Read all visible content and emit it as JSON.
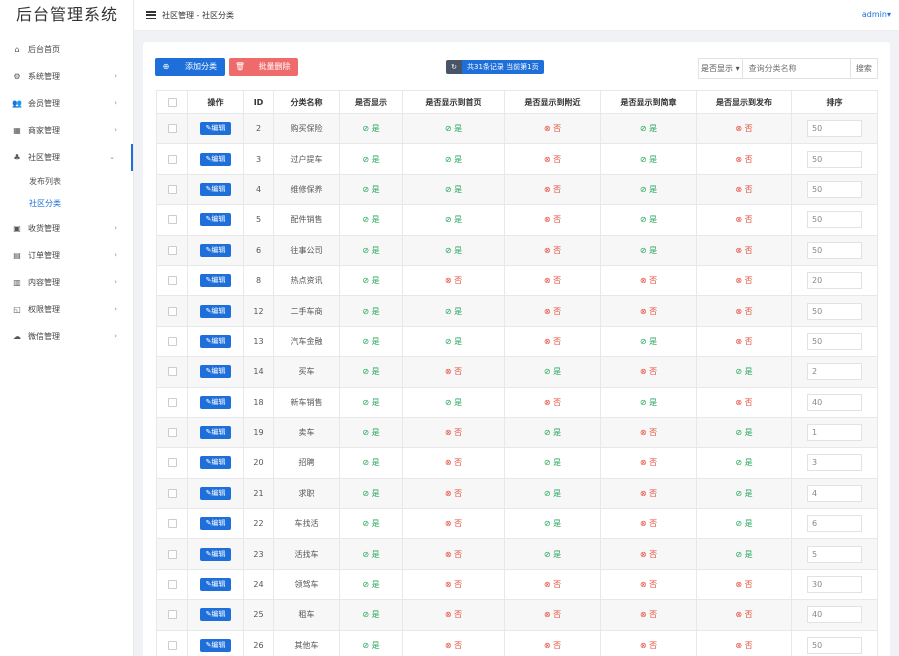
{
  "brand": "后台管理系统",
  "breadcrumb": "社区管理 - 社区分类",
  "user": "admin",
  "sidebar": {
    "items": [
      {
        "label": "后台首页",
        "icon": "home-icon",
        "glyph": "⌂",
        "arrow": ""
      },
      {
        "label": "系统管理",
        "icon": "gear-icon",
        "glyph": "⚙",
        "arrow": "›"
      },
      {
        "label": "会员管理",
        "icon": "users-icon",
        "glyph": "👥",
        "arrow": "›"
      },
      {
        "label": "商家管理",
        "icon": "store-icon",
        "glyph": "▦",
        "arrow": "›"
      },
      {
        "label": "社区管理",
        "icon": "community-icon",
        "glyph": "♣",
        "arrow": "⌄"
      },
      {
        "label": "收货管理",
        "icon": "box-icon",
        "glyph": "▣",
        "arrow": "›"
      },
      {
        "label": "订单管理",
        "icon": "clipboard-icon",
        "glyph": "▤",
        "arrow": "›"
      },
      {
        "label": "内容管理",
        "icon": "document-icon",
        "glyph": "▥",
        "arrow": "›"
      },
      {
        "label": "权限管理",
        "icon": "shield-icon",
        "glyph": "◱",
        "arrow": "›"
      },
      {
        "label": "微信管理",
        "icon": "wechat-icon",
        "glyph": "☁",
        "arrow": "›"
      }
    ],
    "sub_items": [
      {
        "label": "发布列表"
      },
      {
        "label": "社区分类"
      }
    ]
  },
  "toolbar": {
    "add_label": "添加分类",
    "add_icon": "⊕",
    "batch_delete_label": "批量删除",
    "batch_delete_icon": "🗑",
    "stats_icon": "↻",
    "stats_text": "共31条记录 当前第1页",
    "filter_select": "是否显示 ▾",
    "search_placeholder": "查询分类名称",
    "search_button": "搜索"
  },
  "table": {
    "headers": [
      "",
      "操作",
      "ID",
      "分类名称",
      "是否显示",
      "是否显示到首页",
      "是否显示到附近",
      "是否显示到简章",
      "是否显示到发布",
      "排序"
    ],
    "edit_label": "✎编辑",
    "yes_label": "⊘ 是",
    "no_label": "⊗ 否",
    "rows": [
      {
        "id": "2",
        "name": "购买保险",
        "flags": [
          1,
          1,
          0,
          1,
          0
        ],
        "sort": "50"
      },
      {
        "id": "3",
        "name": "过户提车",
        "flags": [
          1,
          1,
          0,
          1,
          0
        ],
        "sort": "50"
      },
      {
        "id": "4",
        "name": "维修保养",
        "flags": [
          1,
          1,
          0,
          1,
          0
        ],
        "sort": "50"
      },
      {
        "id": "5",
        "name": "配件销售",
        "flags": [
          1,
          1,
          0,
          1,
          0
        ],
        "sort": "50"
      },
      {
        "id": "6",
        "name": "往事公司",
        "flags": [
          1,
          1,
          0,
          1,
          0
        ],
        "sort": "50"
      },
      {
        "id": "8",
        "name": "热点资讯",
        "flags": [
          1,
          0,
          0,
          0,
          0
        ],
        "sort": "20"
      },
      {
        "id": "12",
        "name": "二手车商",
        "flags": [
          1,
          1,
          0,
          0,
          0
        ],
        "sort": "50"
      },
      {
        "id": "13",
        "name": "汽车金融",
        "flags": [
          1,
          1,
          0,
          1,
          0
        ],
        "sort": "50"
      },
      {
        "id": "14",
        "name": "买车",
        "flags": [
          1,
          0,
          1,
          0,
          1
        ],
        "sort": "2"
      },
      {
        "id": "18",
        "name": "新车销售",
        "flags": [
          1,
          1,
          0,
          1,
          0
        ],
        "sort": "40"
      },
      {
        "id": "19",
        "name": "卖车",
        "flags": [
          1,
          0,
          1,
          0,
          1
        ],
        "sort": "1"
      },
      {
        "id": "20",
        "name": "招聘",
        "flags": [
          1,
          0,
          1,
          0,
          1
        ],
        "sort": "3"
      },
      {
        "id": "21",
        "name": "求职",
        "flags": [
          1,
          0,
          1,
          0,
          1
        ],
        "sort": "4"
      },
      {
        "id": "22",
        "name": "车找活",
        "flags": [
          1,
          0,
          1,
          0,
          1
        ],
        "sort": "6"
      },
      {
        "id": "23",
        "name": "活找车",
        "flags": [
          1,
          0,
          1,
          0,
          1
        ],
        "sort": "5"
      },
      {
        "id": "24",
        "name": "领驾车",
        "flags": [
          1,
          0,
          0,
          0,
          0
        ],
        "sort": "30"
      },
      {
        "id": "25",
        "name": "租车",
        "flags": [
          1,
          0,
          0,
          0,
          0
        ],
        "sort": "40"
      },
      {
        "id": "26",
        "name": "其他车",
        "flags": [
          1,
          0,
          0,
          0,
          0
        ],
        "sort": "50"
      }
    ]
  },
  "colors": {
    "primary": "#1e6fd9",
    "danger": "#ef6b6b",
    "yes": "#26a65b",
    "no": "#e74c3c"
  }
}
